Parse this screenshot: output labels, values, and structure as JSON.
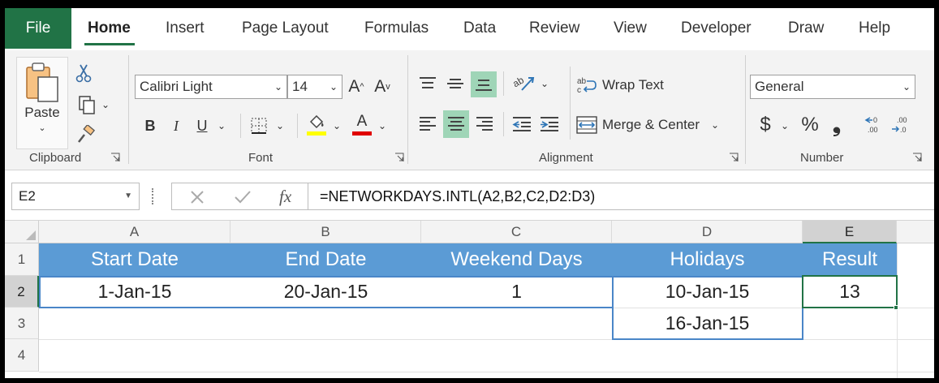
{
  "ribbon_tabs": [
    "File",
    "Home",
    "Insert",
    "Page Layout",
    "Formulas",
    "Data",
    "Review",
    "View",
    "Developer",
    "Draw",
    "Help"
  ],
  "clipboard": {
    "paste_label": "Paste",
    "group_label": "Clipboard"
  },
  "font": {
    "name": "Calibri Light",
    "size": "14",
    "group_label": "Font",
    "bold": "B",
    "italic": "I",
    "underline": "U",
    "grow": "A",
    "shrink": "A",
    "font_color_letter": "A"
  },
  "alignment": {
    "wrap_text": "Wrap Text",
    "merge_center": "Merge & Center",
    "group_label": "Alignment"
  },
  "number": {
    "format": "General",
    "group_label": "Number",
    "dollar": "$",
    "percent": "%",
    "comma": "❟",
    "inc_decimal_top": "←0",
    ".inc_decimal_bottom": ".00",
    "dec_decimal_top": ".00",
    "dec_decimal_bottom": "→.0"
  },
  "formula_bar": {
    "name_box": "E2",
    "fx": "fx",
    "formula": "=NETWORKDAYS.INTL(A2,B2,C2,D2:D3)"
  },
  "columns": [
    "A",
    "B",
    "C",
    "D",
    "E"
  ],
  "rows": [
    "1",
    "2",
    "3",
    "4"
  ],
  "sheet": {
    "headers": [
      "Start Date",
      "End Date",
      "Weekend Days",
      "Holidays",
      "Result"
    ],
    "row2": [
      "1-Jan-15",
      "20-Jan-15",
      "1",
      "10-Jan-15",
      "13"
    ],
    "row3_d": "16-Jan-15"
  },
  "colors": {
    "excel_green": "#217346",
    "header_blue": "#5b9bd5",
    "selection_green": "#217346"
  }
}
